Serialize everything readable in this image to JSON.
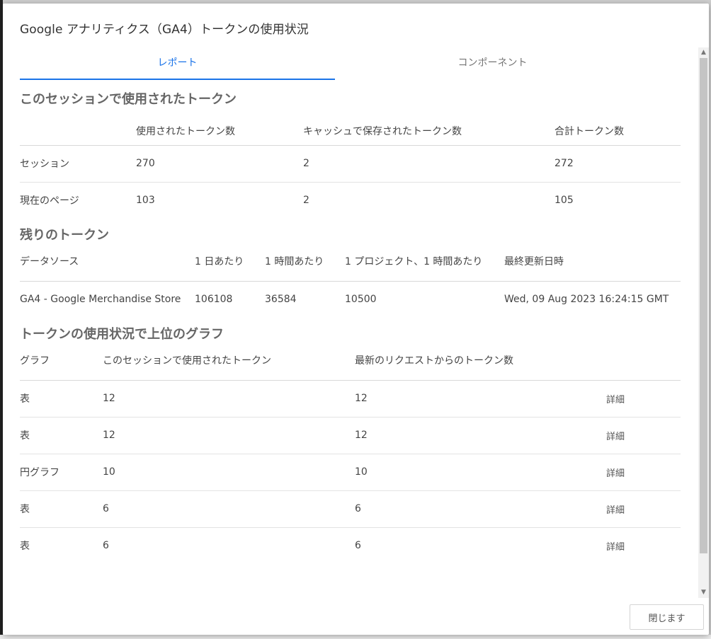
{
  "dialog": {
    "title": "Google アナリティクス（GA4）トークンの使用状況",
    "close_label": "閉じます"
  },
  "tabs": [
    {
      "label": "レポート",
      "active": true
    },
    {
      "label": "コンポーネント",
      "active": false
    }
  ],
  "session_tokens": {
    "title": "このセッションで使用されたトークン",
    "headers": [
      "",
      "使用されたトークン数",
      "キャッシュで保存されたトークン数",
      "合計トークン数"
    ],
    "rows": [
      [
        "セッション",
        "270",
        "2",
        "272"
      ],
      [
        "現在のページ",
        "103",
        "2",
        "105"
      ]
    ]
  },
  "remaining_tokens": {
    "title": "残りのトークン",
    "headers": [
      "データソース",
      "1 日あたり",
      "1 時間あたり",
      "1 プロジェクト、1 時間あたり",
      "最終更新日時"
    ],
    "rows": [
      [
        "GA4 - Google Merchandise Store",
        "106108",
        "36584",
        "10500",
        "Wed, 09 Aug 2023 16:24:15 GMT"
      ]
    ]
  },
  "top_charts": {
    "title": "トークンの使用状況で上位のグラフ",
    "headers": [
      "グラフ",
      "このセッションで使用されたトークン",
      "最新のリクエストからのトークン数",
      ""
    ],
    "detail_label": "詳細",
    "rows": [
      [
        "表",
        "12",
        "12"
      ],
      [
        "表",
        "12",
        "12"
      ],
      [
        "円グラフ",
        "10",
        "10"
      ],
      [
        "表",
        "6",
        "6"
      ],
      [
        "表",
        "6",
        "6"
      ]
    ]
  },
  "colors": {
    "accent": "#1a73e8",
    "section_title": "#666666"
  },
  "icons": {
    "scroll_up": "▲",
    "scroll_down": "▼"
  }
}
